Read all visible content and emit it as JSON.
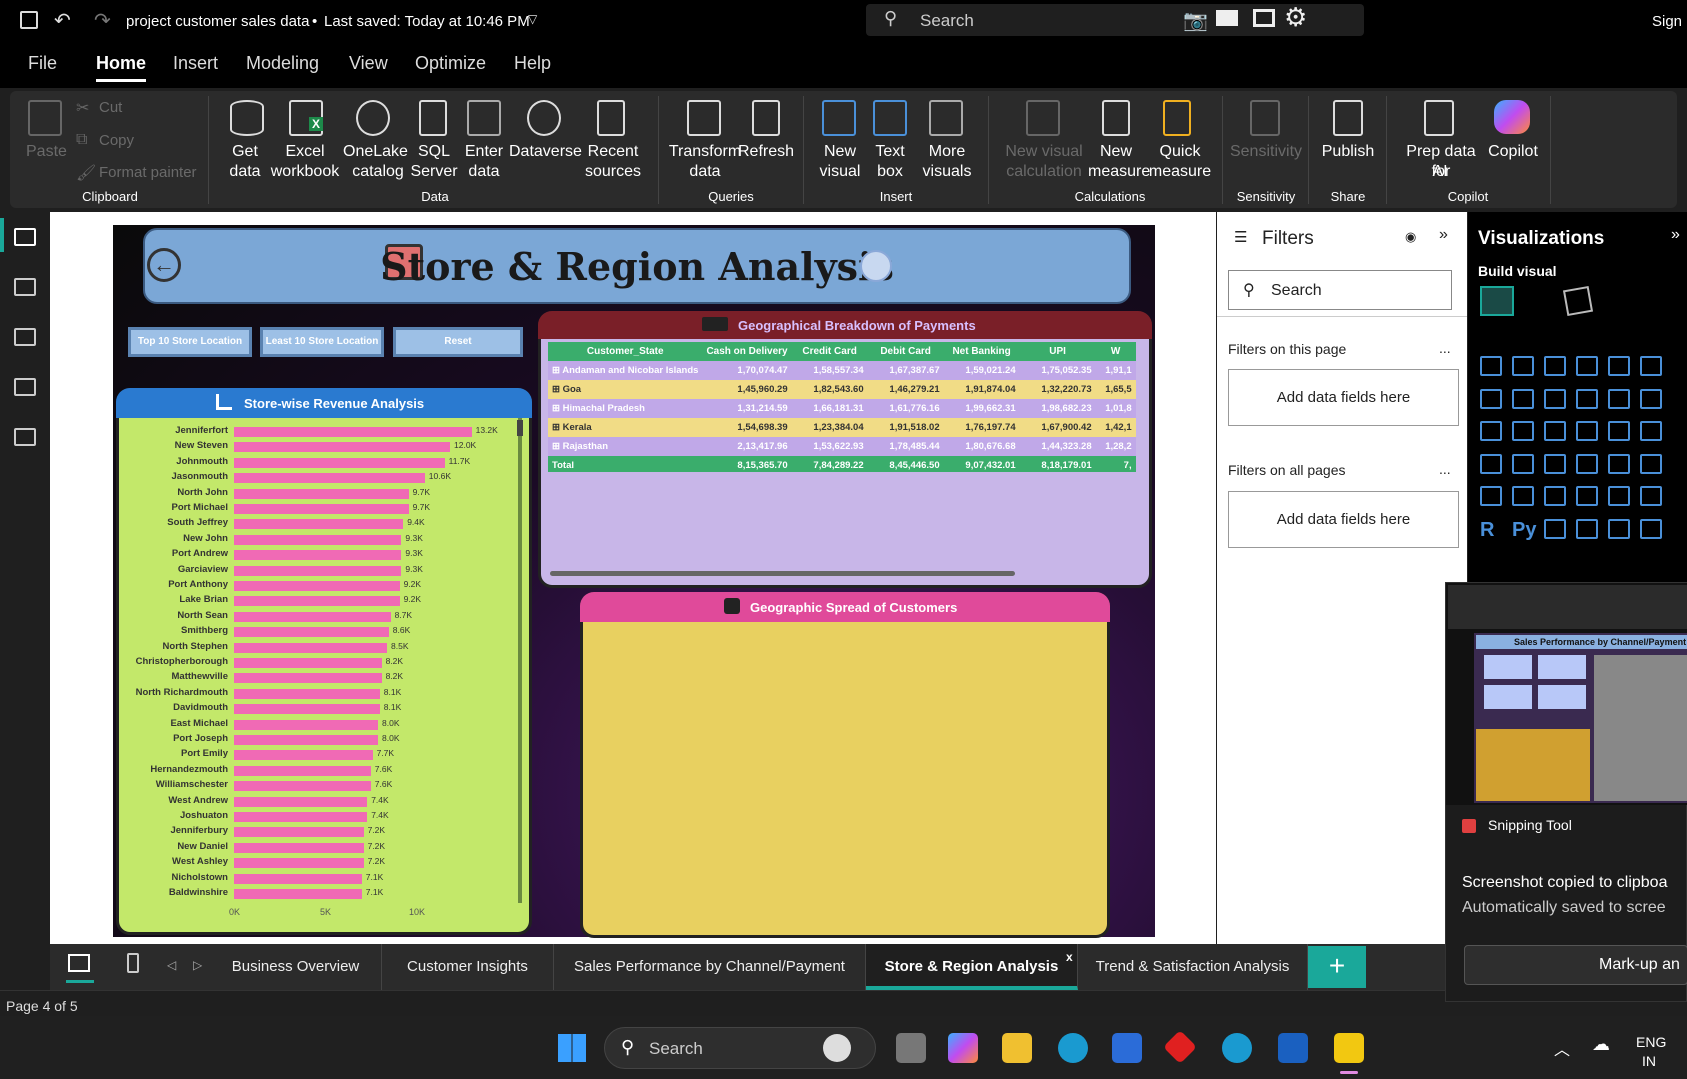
{
  "titlebar": {
    "doc_title": "project customer sales data",
    "saved": "Last saved: Today at 10:46 PM",
    "search_label": "Search",
    "sign": "Sign"
  },
  "menu": {
    "items": [
      "File",
      "Home",
      "Insert",
      "Modeling",
      "View",
      "Optimize",
      "Help"
    ]
  },
  "ribbon": {
    "paste": "Paste",
    "cut": "Cut",
    "copy": "Copy",
    "format_painter": "Format painter",
    "clipboard": "Clipboard",
    "get_data_1": "Get",
    "get_data_2": "data",
    "excel_1": "Excel",
    "excel_2": "workbook",
    "onelake_1": "OneLake",
    "onelake_2": "catalog",
    "sql_1": "SQL",
    "sql_2": "Server",
    "enter_1": "Enter",
    "enter_2": "data",
    "dataverse": "Dataverse",
    "recent_1": "Recent",
    "recent_2": "sources",
    "data_group": "Data",
    "transform_1": "Transform",
    "transform_2": "data",
    "refresh": "Refresh",
    "queries": "Queries",
    "newvisual_1": "New",
    "newvisual_2": "visual",
    "textbox_1": "Text",
    "textbox_2": "box",
    "morevis_1": "More",
    "morevis_2": "visuals",
    "insert_group": "Insert",
    "nvcalc_1": "New visual",
    "nvcalc_2": "calculation",
    "newmeasure_1": "New",
    "newmeasure_2": "measure",
    "quick_1": "Quick",
    "quick_2": "measure",
    "calc_group": "Calculations",
    "sensitivity": "Sensitivity",
    "sens_group": "Sensitivity",
    "publish": "Publish",
    "share_group": "Share",
    "prep_1": "Prep data for",
    "prep_2": "AI",
    "copilot": "Copilot",
    "copilot_group": "Copilot"
  },
  "report": {
    "title": "Store & Region Analysis",
    "btn_top": "Top 10 Store Location",
    "btn_least": "Least 10 Store Location",
    "btn_reset": "Reset",
    "bar_title": "Store-wise Revenue Analysis",
    "table_title": "Geographical Breakdown of Payments",
    "map_title": "Geographic Spread of Customers"
  },
  "chart_data": {
    "type": "bar",
    "title": "Store-wise Revenue Analysis",
    "orientation": "horizontal",
    "categories": [
      "Jenniferfort",
      "New Steven",
      "Johnmouth",
      "Jasonmouth",
      "North John",
      "Port Michael",
      "South Jeffrey",
      "New John",
      "Port Andrew",
      "Garciaview",
      "Port Anthony",
      "Lake Brian",
      "North Sean",
      "Smithberg",
      "North Stephen",
      "Christopherborough",
      "Matthewville",
      "North Richardmouth",
      "Davidmouth",
      "East Michael",
      "Port Joseph",
      "Port Emily",
      "Hernandezmouth",
      "Williamschester",
      "West Andrew",
      "Joshuaton",
      "Jenniferbury",
      "New Daniel",
      "West Ashley",
      "Nicholstown",
      "Baldwinshire"
    ],
    "values": [
      13.2,
      12.0,
      11.7,
      10.6,
      9.7,
      9.7,
      9.4,
      9.3,
      9.3,
      9.3,
      9.2,
      9.2,
      8.7,
      8.6,
      8.5,
      8.2,
      8.2,
      8.1,
      8.1,
      8.0,
      8.0,
      7.7,
      7.6,
      7.6,
      7.4,
      7.4,
      7.2,
      7.2,
      7.2,
      7.1,
      7.1
    ],
    "labels": [
      "13.2K",
      "12.0K",
      "11.7K",
      "10.6K",
      "9.7K",
      "9.7K",
      "9.4K",
      "9.3K",
      "9.3K",
      "9.3K",
      "9.2K",
      "9.2K",
      "8.7K",
      "8.6K",
      "8.5K",
      "8.2K",
      "8.2K",
      "8.1K",
      "8.1K",
      "8.0K",
      "8.0K",
      "7.7K",
      "7.6K",
      "7.6K",
      "7.4K",
      "7.4K",
      "7.2K",
      "7.2K",
      "7.2K",
      "7.1K",
      "7.1K"
    ],
    "xticks": [
      "0K",
      "5K",
      "10K"
    ],
    "xlim": [
      0,
      15
    ]
  },
  "payments_table": {
    "columns": [
      "Customer_State",
      "Cash on Delivery",
      "Credit Card",
      "Debit Card",
      "Net Banking",
      "UPI",
      "W"
    ],
    "rows": [
      [
        "Andaman and Nicobar Islands",
        "1,70,074.47",
        "1,58,557.34",
        "1,67,387.67",
        "1,59,021.24",
        "1,75,052.35",
        "1,91,1"
      ],
      [
        "Goa",
        "1,45,960.29",
        "1,82,543.60",
        "1,46,279.21",
        "1,91,874.04",
        "1,32,220.73",
        "1,65,5"
      ],
      [
        "Himachal Pradesh",
        "1,31,214.59",
        "1,66,181.31",
        "1,61,776.16",
        "1,99,662.31",
        "1,98,682.23",
        "1,01,8"
      ],
      [
        "Kerala",
        "1,54,698.39",
        "1,23,384.04",
        "1,91,518.02",
        "1,76,197.74",
        "1,67,900.42",
        "1,42,1"
      ],
      [
        "Rajasthan",
        "2,13,417.96",
        "1,53,622.93",
        "1,78,485.44",
        "1,80,676.68",
        "1,44,323.28",
        "1,28,2"
      ]
    ],
    "total": [
      "Total",
      "8,15,365.70",
      "7,84,289.22",
      "8,45,446.50",
      "9,07,432.01",
      "8,18,179.01",
      "7,"
    ]
  },
  "filters": {
    "title": "Filters",
    "search": "Search",
    "on_page": "Filters on this page",
    "add1": "Add data fields here",
    "all_pages": "Filters on all pages",
    "add2": "Add data fields here",
    "more": "..."
  },
  "viz": {
    "title": "Visualizations",
    "build": "Build visual",
    "r": "R",
    "py": "Py"
  },
  "tabs": [
    "Business Overview",
    "Customer Insights",
    "Sales Performance by Channel/Payment",
    "Store & Region Analysis",
    "Trend & Satisfaction Analysis"
  ],
  "tab_close": "x",
  "tab_add": "+",
  "status": "Page 4 of 5",
  "snip": {
    "app": "Snipping Tool",
    "line1": "Screenshot copied to clipboa",
    "line2": "Automatically saved to scree",
    "markup": "Mark-up an",
    "thumb_title": "Sales Performance by Channel/Payment"
  },
  "taskbar": {
    "search": "Search",
    "lang1": "ENG",
    "lang2": "IN"
  }
}
